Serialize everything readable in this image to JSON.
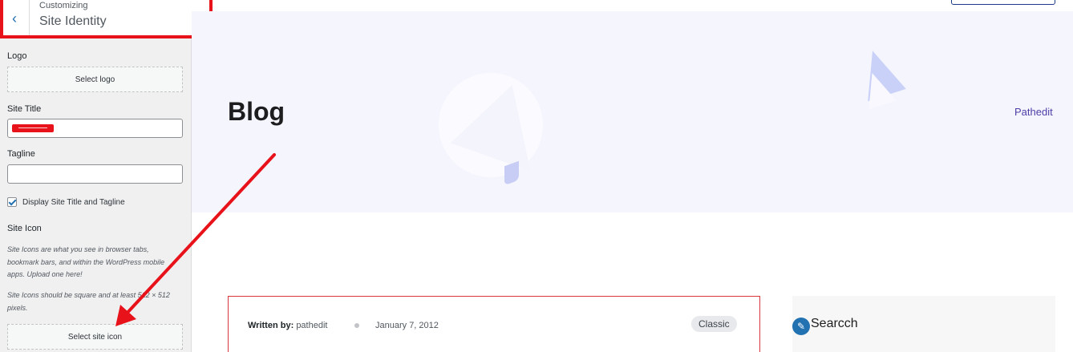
{
  "customizer": {
    "breadcrumb": "Customizing",
    "section_title": "Site Identity",
    "logo": {
      "label": "Logo",
      "button": "Select logo"
    },
    "site_title": {
      "label": "Site Title",
      "value": ""
    },
    "tagline": {
      "label": "Tagline",
      "value": ""
    },
    "display_title_tagline": {
      "label": "Display Site Title and Tagline",
      "checked": true
    },
    "site_icon": {
      "label": "Site Icon",
      "description": "Site Icons are what you see in browser tabs, bookmark bars, and within the WordPress mobile apps. Upload one here!",
      "requirement": "Site Icons should be square and at least 512 × 512 pixels.",
      "button": "Select site icon"
    }
  },
  "preview": {
    "page_title": "Blog",
    "site_link": "Pathedit",
    "post": {
      "written_by_label": "Written by:",
      "author": "pathedit",
      "date": "January 7, 2012",
      "category": "Classic"
    },
    "widget": {
      "title": "Searcch"
    }
  },
  "colors": {
    "annotation_red": "#e8121a",
    "accent_blue": "#2271b1",
    "link_purple": "#4b3fa8",
    "hero_bg": "#f5f5fd"
  },
  "icons": {
    "back": "chevron-left-icon",
    "widget": "pencil-icon",
    "checkbox": "checkmark-icon"
  }
}
